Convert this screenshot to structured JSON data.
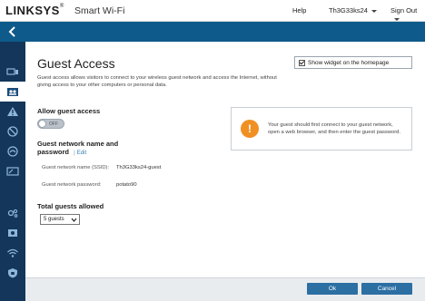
{
  "header": {
    "brand": "LINKSYS",
    "brand_mark": "®",
    "product": "Smart Wi-Fi",
    "help_label": "Help",
    "router_name": "Th3G33ks24",
    "signout_label": "Sign Out"
  },
  "sidebar": {
    "items": [
      {
        "icon": "device-list-icon",
        "active": false
      },
      {
        "icon": "guest-access-icon",
        "active": true
      },
      {
        "icon": "troubleshooting-icon",
        "active": false
      },
      {
        "icon": "parental-controls-icon",
        "active": false
      },
      {
        "icon": "media-prioritization-icon",
        "active": false
      },
      {
        "icon": "speed-test-icon",
        "active": false
      },
      {
        "icon": "connectivity-icon",
        "active": false
      },
      {
        "icon": "external-storage-icon",
        "active": false
      },
      {
        "icon": "wireless-icon",
        "active": false
      },
      {
        "icon": "security-icon",
        "active": false
      }
    ]
  },
  "guest_access": {
    "title": "Guest Access",
    "show_widget_label": "Show widget on the homepage",
    "show_widget_checked": true,
    "description": "Guest access allows visitors to connect to your wireless guest network and access the Internet, without giving access to your other computers or personal data.",
    "allow_label": "Allow guest access",
    "allow_state": "OFF",
    "network_heading_line1": "Guest network name and",
    "network_heading_line2": "password",
    "edit_label": "Edit",
    "ssid_label": "Guest network name (SSID):",
    "ssid_value": "Th3G33ks24-guest",
    "password_label": "Guest network password:",
    "password_value": "potato90",
    "total_guests_label": "Total guests allowed",
    "total_guests_value": "5 guests",
    "notice_text": "Your guest should first connect to your guest network, open a web browser, and then enter the guest password."
  },
  "footer": {
    "ok_label": "Ok",
    "cancel_label": "Cancel"
  },
  "colors": {
    "nav_blue": "#0e5a8a",
    "sidebar_navy": "#13365a",
    "button_blue": "#2b6fa3",
    "notice_orange": "#f09023"
  }
}
